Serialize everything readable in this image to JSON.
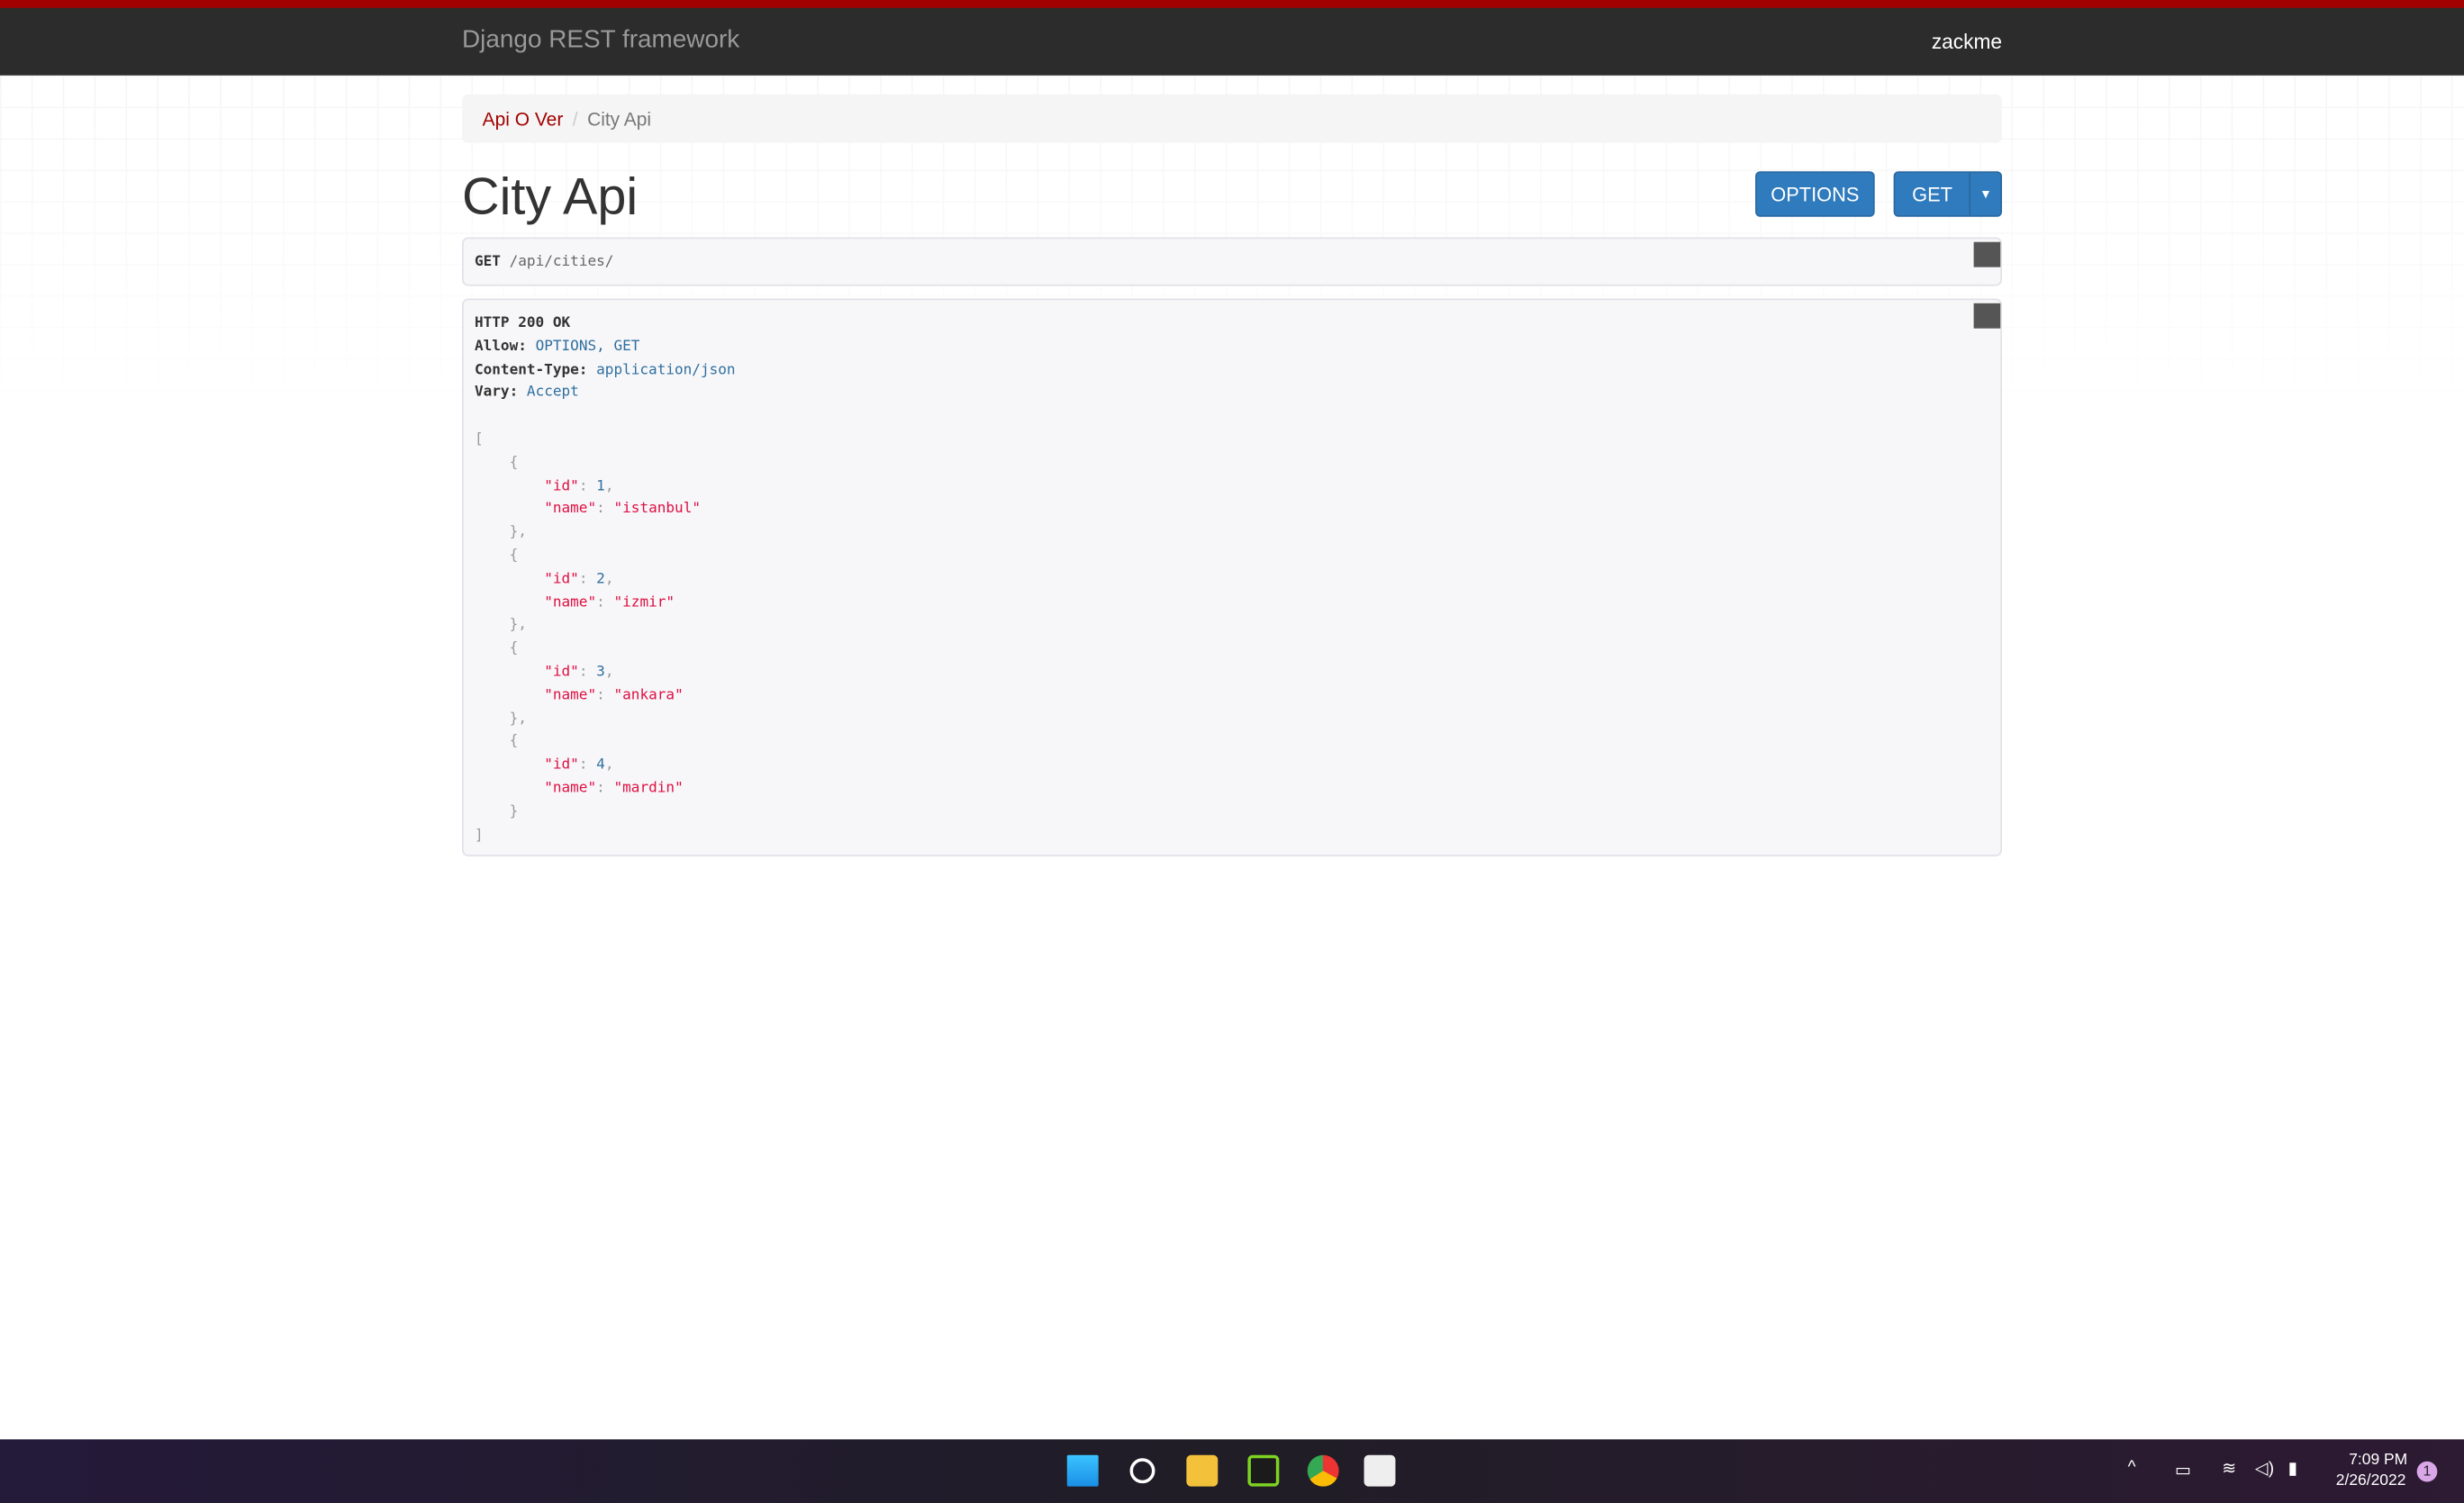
{
  "navbar": {
    "brand": "Django REST framework",
    "user": "zackme"
  },
  "breadcrumb": [
    {
      "label": "Api O Ver"
    },
    {
      "label": "City Api"
    }
  ],
  "page_title": "City Api",
  "buttons": {
    "options": "OPTIONS",
    "get": "GET"
  },
  "request": {
    "method": "GET",
    "path": "/api/cities/"
  },
  "response": {
    "status": "HTTP 200 OK",
    "headers": [
      {
        "key": "Allow:",
        "value": "OPTIONS, GET"
      },
      {
        "key": "Content-Type:",
        "value": "application/json"
      },
      {
        "key": "Vary:",
        "value": "Accept"
      }
    ],
    "body": [
      {
        "id": 1,
        "name": "istanbul"
      },
      {
        "id": 2,
        "name": "izmir"
      },
      {
        "id": 3,
        "name": "ankara"
      },
      {
        "id": 4,
        "name": "mardin"
      }
    ]
  },
  "taskbar": {
    "time": "7:09 PM",
    "date": "2/26/2022",
    "notifications": "1"
  }
}
